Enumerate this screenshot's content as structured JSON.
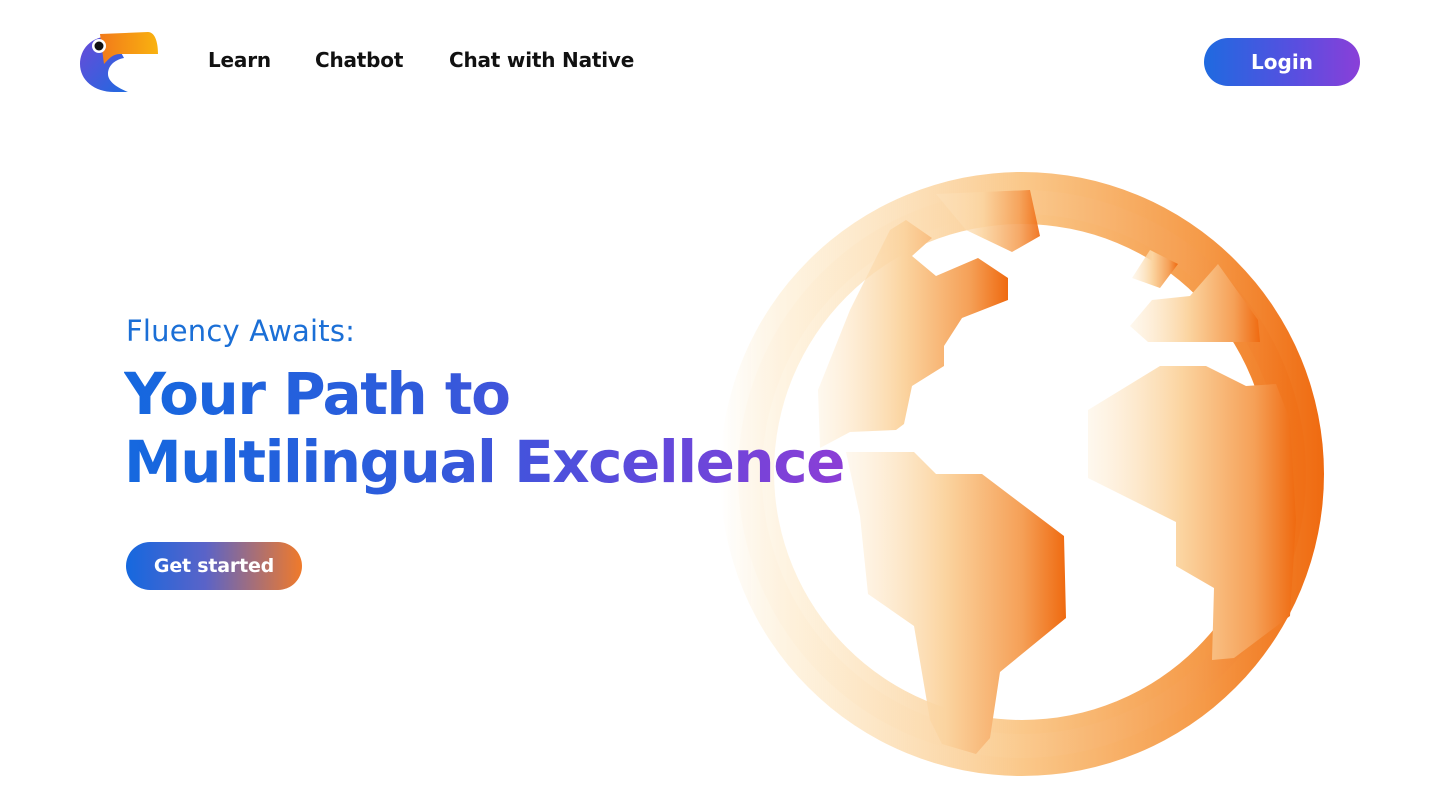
{
  "header": {
    "logo_name": "toucan-logo",
    "nav": [
      {
        "label": "Learn"
      },
      {
        "label": "Chatbot"
      },
      {
        "label": "Chat with Native"
      }
    ],
    "login_label": "Login"
  },
  "hero": {
    "eyebrow": "Fluency Awaits:",
    "title_line1": "Your Path to",
    "title_line2": "Multilingual Excellence",
    "cta_label": "Get started",
    "illustration": "globe-illustration"
  },
  "colors": {
    "brand_blue": "#1568df",
    "brand_purple": "#8a3fd8",
    "brand_orange": "#f07a2a",
    "text_dark": "#111111"
  }
}
